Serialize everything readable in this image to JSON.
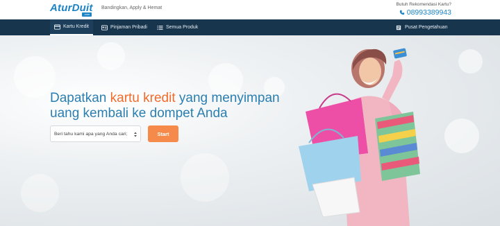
{
  "header": {
    "logo": "AturDuit",
    "logo_badge": ".com",
    "tagline": "Bandingkan, Apply & Hemat",
    "contact_label": "Butuh Rekomendasi Kartu?",
    "phone": "08993389943"
  },
  "nav": {
    "items": [
      {
        "label": "Kartu Kredit",
        "icon": "credit-card-icon",
        "active": true
      },
      {
        "label": "Pinjaman Pribadi",
        "icon": "id-card-icon",
        "active": false
      },
      {
        "label": "Semua Produk",
        "icon": "list-icon",
        "active": false
      }
    ],
    "right_label": "Pusat Pengetahuan",
    "right_icon": "document-icon"
  },
  "hero": {
    "headline_part1": "Dapatkan ",
    "headline_highlight": "kartu kredit",
    "headline_part2": " yang menyimpan",
    "headline_line2": "uang kembali ke dompet Anda",
    "select_placeholder": "Beri tahu kami apa yang Anda cari;",
    "start_label": "Start"
  },
  "colors": {
    "brand_blue": "#1b83c6",
    "nav_bg": "#17354d",
    "accent_orange": "#f26b2a",
    "button_orange": "#f58a4a"
  }
}
